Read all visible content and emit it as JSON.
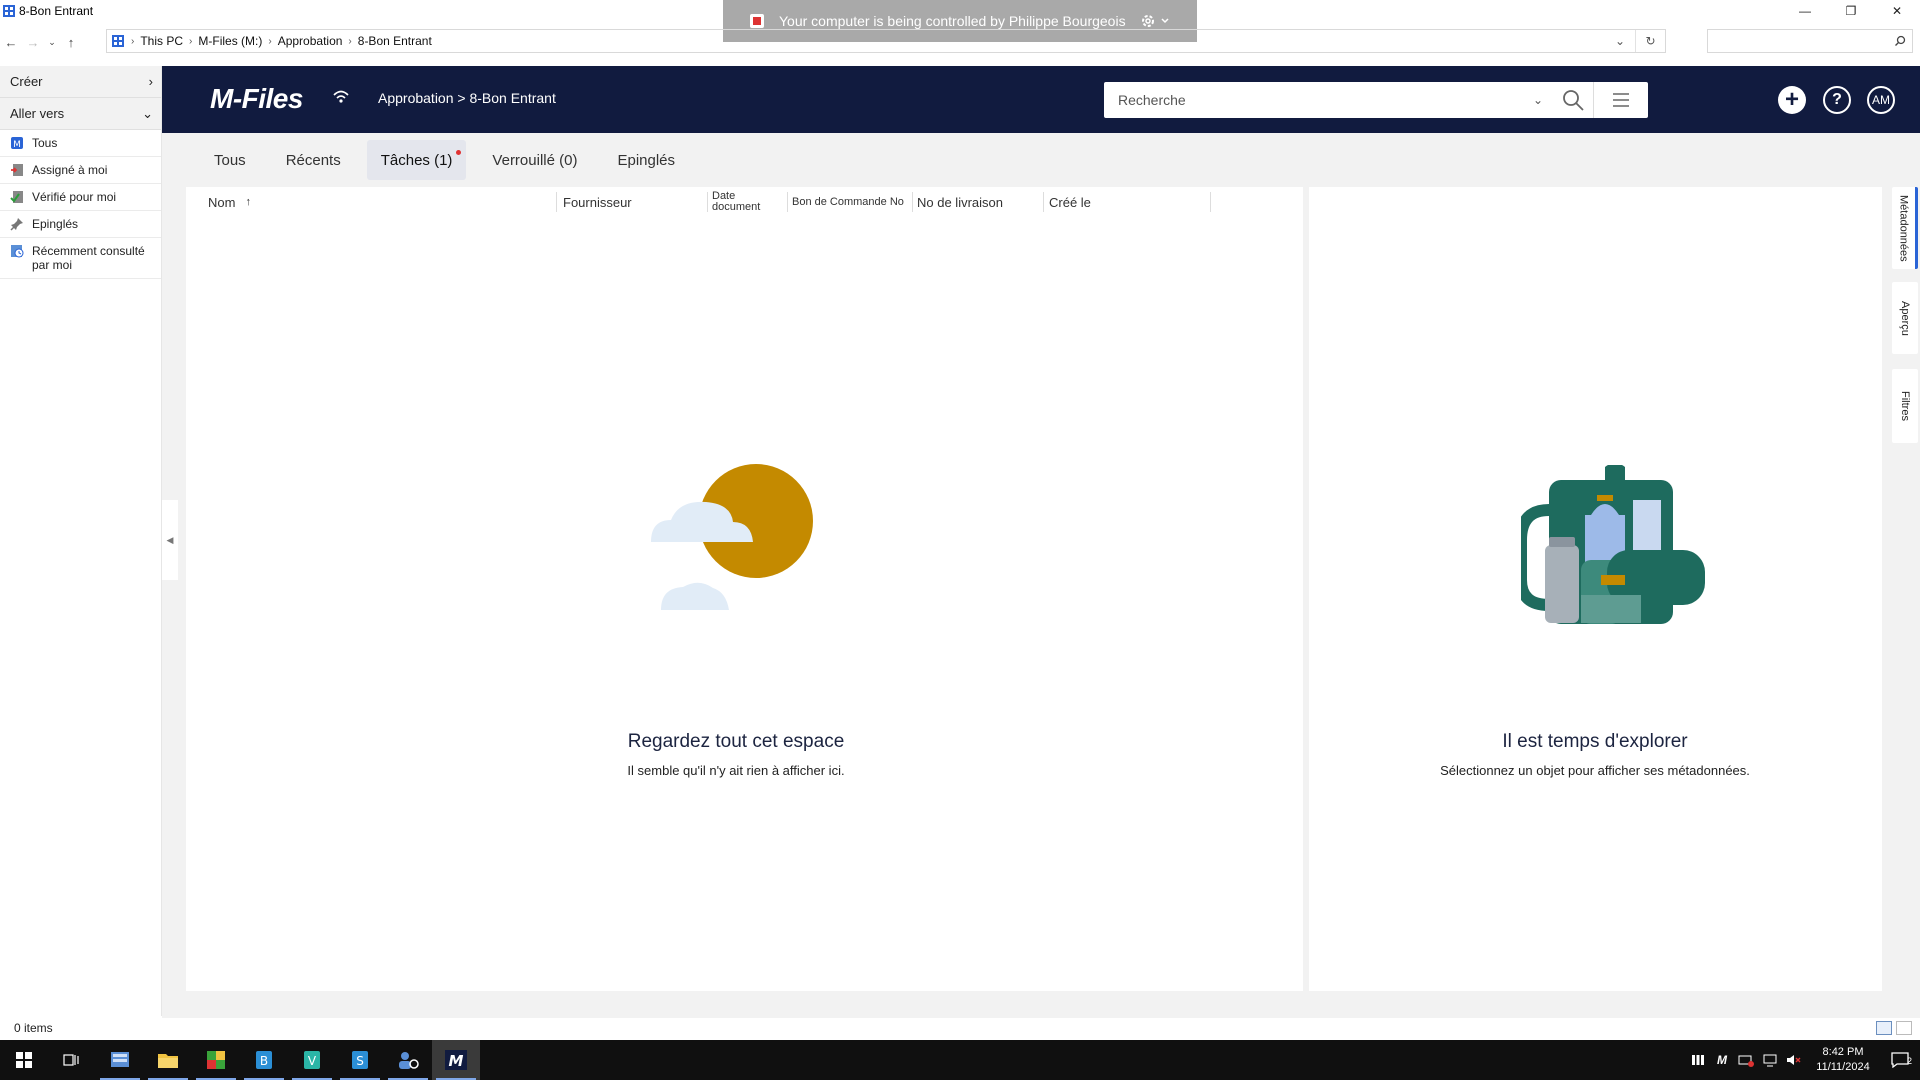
{
  "window": {
    "title": "8-Bon Entrant",
    "minimize": "—",
    "restore": "❐",
    "close": "✕"
  },
  "remote_banner": {
    "text": "Your computer is being controlled by Philippe Bourgeois"
  },
  "address_bar": {
    "crumbs": [
      "This PC",
      "M-Files (M:)",
      "Approbation",
      "8-Bon Entrant"
    ],
    "separator": "›"
  },
  "left_pane": {
    "creer": "Créer",
    "aller_vers": "Aller vers",
    "items": [
      {
        "label": "Tous",
        "icon": "all-icon"
      },
      {
        "label": "Assigné à moi",
        "icon": "assigned-icon"
      },
      {
        "label": "Vérifié pour moi",
        "icon": "checked-icon"
      },
      {
        "label": "Epinglés",
        "icon": "pin-icon"
      },
      {
        "label": "Récemment consulté par moi",
        "icon": "recent-icon"
      }
    ]
  },
  "mfiles": {
    "logo": "M-Files",
    "breadcrumb": "Approbation > 8-Bon Entrant",
    "search_placeholder": "Recherche",
    "avatar": "AM",
    "help": "?",
    "add": "+"
  },
  "tabs": [
    {
      "label": "Tous",
      "active": false
    },
    {
      "label": "Récents",
      "active": false
    },
    {
      "label": "Tâches (1)",
      "active": true
    },
    {
      "label": "Verrouillé (0)",
      "active": false
    },
    {
      "label": "Epinglés",
      "active": false
    }
  ],
  "columns": {
    "nom": "Nom",
    "sort_arrow": "↑",
    "fournisseur": "Fournisseur",
    "date_document_1": "Date",
    "date_document_2": "document",
    "bon_commande": "Bon de Commande No",
    "no_livraison": "No de livraison",
    "cree_le": "Créé le"
  },
  "empty_list": {
    "heading": "Regardez tout cet espace",
    "sub": "Il semble qu'il n'y ait rien à afficher ici."
  },
  "empty_meta": {
    "heading": "Il est temps d'explorer",
    "sub": "Sélectionnez un objet pour afficher ses métadonnées."
  },
  "side_tabs": {
    "metadata": "Métadonnées",
    "apercu": "Aperçu",
    "filtres": "Filtres"
  },
  "status": {
    "items": "0 items"
  },
  "taskbar": {
    "time": "8:42 PM",
    "date": "11/11/2024",
    "notifications": "2"
  },
  "colors": {
    "mfiles_header": "#111b3f",
    "accent_blue": "#2a64d6",
    "sun": "#c48a00",
    "backpack_green": "#1e6b5e"
  }
}
